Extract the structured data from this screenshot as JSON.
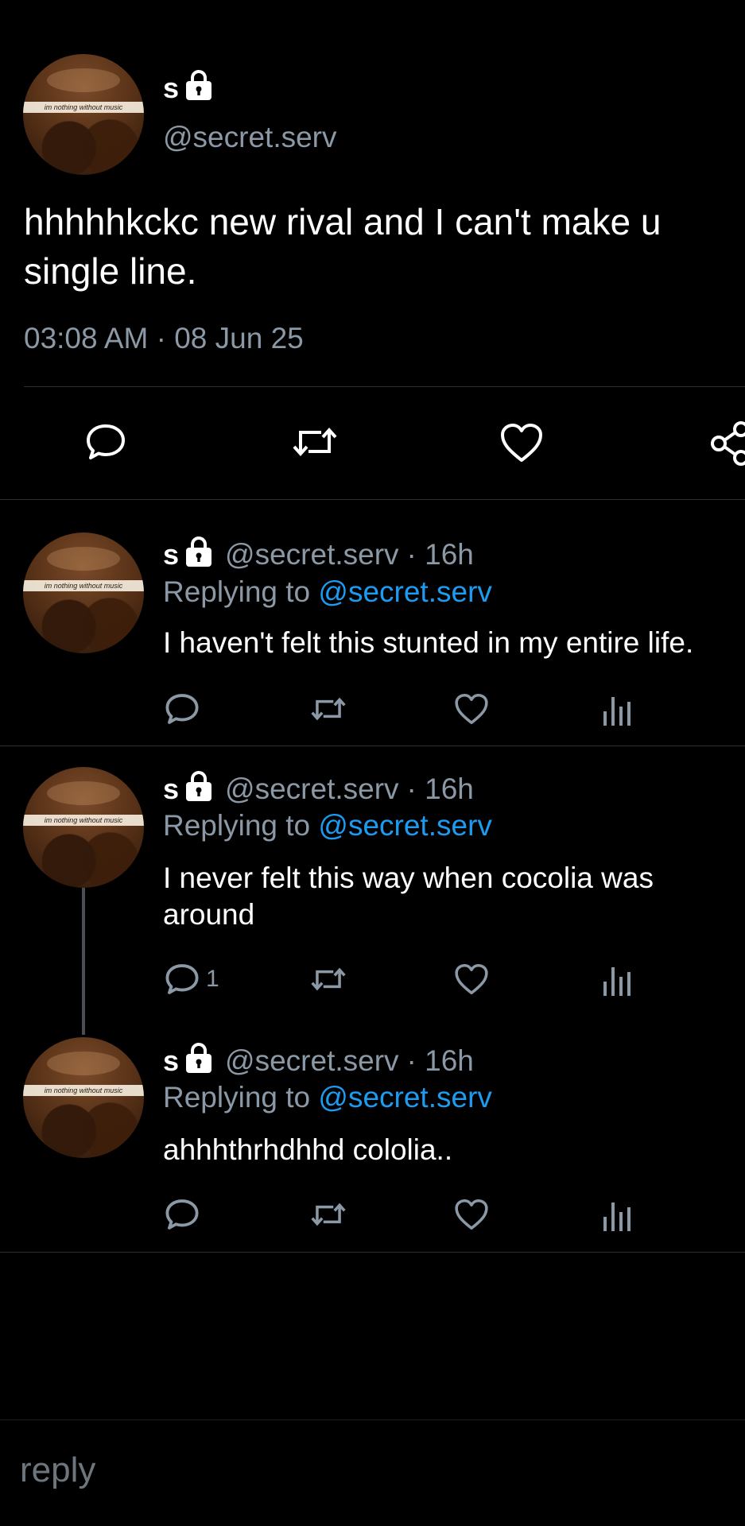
{
  "main_post": {
    "display_name": "s",
    "handle": "@secret.serv",
    "avatar_caption": "im nothing without music",
    "text_line1": "hhhhhkckc new rival and I can't make u",
    "text_line2": "single line.",
    "timestamp": "03:08 AM · 08 Jun 25"
  },
  "replies": [
    {
      "display_name": "s",
      "handle": "@secret.serv",
      "age": "· 16h",
      "replying_label": "Replying to",
      "replying_handle": "@secret.serv",
      "text_line1": "I haven't felt this stunted in my entire life.",
      "text_line2": "",
      "reply_count": ""
    },
    {
      "display_name": "s",
      "handle": "@secret.serv",
      "age": "· 16h",
      "replying_label": "Replying to",
      "replying_handle": "@secret.serv",
      "text_line1": "I never felt this way when cocolia was",
      "text_line2": "around",
      "reply_count": "1"
    },
    {
      "display_name": "s",
      "handle": "@secret.serv",
      "age": "· 16h",
      "replying_label": "Replying to",
      "replying_handle": "@secret.serv",
      "text_line1": "ahhhthrhdhhd cololia..",
      "text_line2": "",
      "reply_count": ""
    }
  ],
  "composer": {
    "placeholder": "reply"
  },
  "colors": {
    "link": "#1d9bf0",
    "muted": "#8b98a5",
    "background": "#000000"
  }
}
